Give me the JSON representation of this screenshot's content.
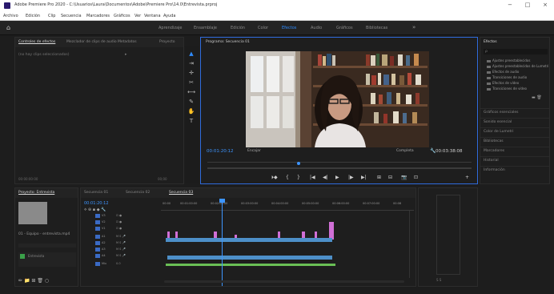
{
  "window": {
    "title": "Adobe Premiere Pro 2020 - C:\\Usuarios\\Laura\\Documentos\\Adobe\\Premiere Pro\\14.0\\Entrevista.prproj",
    "controls": {
      "minimize": "−",
      "maximize": "□",
      "close": "×"
    }
  },
  "menu": [
    "Archivo",
    "Edición",
    "Clip",
    "Secuencia",
    "Marcadores",
    "Gráficos",
    "Ver",
    "Ventana",
    "Ayuda"
  ],
  "workspaces": {
    "items": [
      "Aprendizaje",
      "Ensamblaje",
      "Edición",
      "Color",
      "Efectos",
      "Audio",
      "Gráficos",
      "Bibliotecas"
    ],
    "active_index": 4,
    "more": "»"
  },
  "project_panel": {
    "tabs": [
      "Controles de efectos",
      "Mezclador de clips de audio",
      "Metadatos",
      "Proyecto"
    ],
    "active_index": 0,
    "content_label": "(no hay clips seleccionados)",
    "footer_time": "00:00:00:00",
    "footer_right": "00;00"
  },
  "tools": [
    {
      "icon": "selection-tool-icon",
      "glyph": "▲"
    },
    {
      "icon": "track-select-tool-icon",
      "glyph": "⇥"
    },
    {
      "icon": "ripple-edit-tool-icon",
      "glyph": "✛"
    },
    {
      "icon": "razor-tool-icon",
      "glyph": "✂"
    },
    {
      "icon": "slip-tool-icon",
      "glyph": "⟷"
    },
    {
      "icon": "pen-tool-icon",
      "glyph": "✎"
    },
    {
      "icon": "hand-tool-icon",
      "glyph": "✋"
    },
    {
      "icon": "type-tool-icon",
      "glyph": "T"
    }
  ],
  "program_monitor": {
    "title": "Programa: Secuencia 01",
    "timecode_current": "00:01:20:12",
    "fit": "Encajar",
    "quality": "Completa",
    "timecode_duration": "00:03:38:08",
    "transport": [
      "⏵◆",
      "{",
      "}",
      "|◀",
      "◀|",
      "▶",
      "|▶",
      "▶|",
      "⊞",
      "⊟",
      "📷",
      "⊡"
    ]
  },
  "effects_panel": {
    "title": "Efectos",
    "search_placeholder": "ρ",
    "presets": [
      "Ajustes preestablecidos",
      "Ajustes preestablecidos de Lumetri",
      "Efectos de audio",
      "Transiciones de audio",
      "Efectos de vídeo",
      "Transiciones de vídeo"
    ],
    "sections": [
      "Gráficos esenciales",
      "Sonido esencial",
      "Color de Lumetri",
      "Bibliotecas",
      "Marcadores",
      "Historial",
      "Información"
    ]
  },
  "media_panel": {
    "tabs": [
      "Proyecto: Entrevista"
    ],
    "clip_name": "01 - Equipo - entrevista.mp4",
    "slot_label": "Entrevista",
    "icons": [
      "✏",
      "📁",
      "⊞",
      "🗑",
      "○"
    ]
  },
  "timeline": {
    "tabs": [
      "Secuencia 01",
      "Secuencia 02",
      "Secuencia 03"
    ],
    "active_index": 2,
    "timecode": "00:01:20:12",
    "tool_glyphs": [
      "⟡",
      "⊕",
      "▪",
      "◆",
      "🔧"
    ],
    "ruler_labels": [
      "00:00",
      "00:01:00:00",
      "00:02:00:00",
      "00:03:00:00",
      "00:04:00:00",
      "00:05:00:00",
      "00:06:00:00",
      "00:07:00:00",
      "00:08"
    ],
    "tracks": [
      {
        "name": "V3",
        "icons": "⊡ ●"
      },
      {
        "name": "V2",
        "icons": "⊡ ●"
      },
      {
        "name": "V1",
        "icons": "⊡ ●"
      },
      {
        "name": "A1",
        "icons": "M S 🎤"
      },
      {
        "name": "A2",
        "icons": "M S 🎤"
      },
      {
        "name": "A3",
        "icons": "M S 🎤"
      },
      {
        "name": "A4",
        "icons": "M S 🎤"
      },
      {
        "name": "Mix",
        "icons": "0.0"
      }
    ]
  },
  "audio_meters": {
    "bottom_labels": "S   S"
  }
}
